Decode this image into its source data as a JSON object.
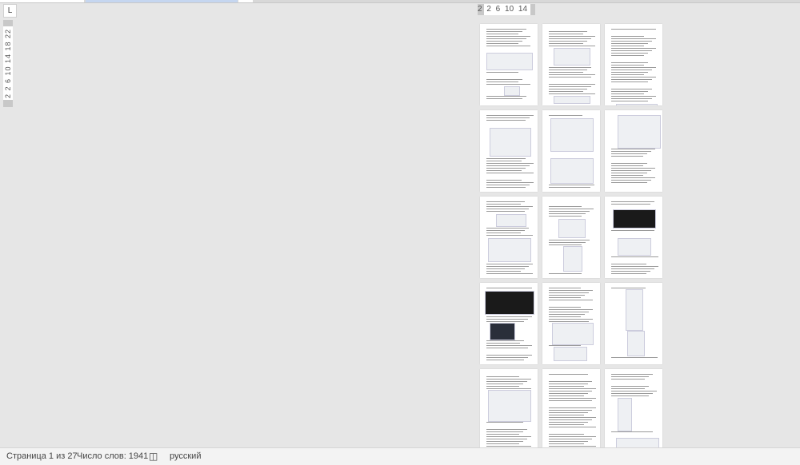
{
  "ruler": {
    "vertical_numbers": "2 2 6 10 14 18 22",
    "horizontal_numbers": "2 2 6 10 14",
    "tab_selector_symbol": "L"
  },
  "document": {
    "visible_page_count": 15,
    "columns": 3
  },
  "status": {
    "page": "Страница 1 из 27",
    "words": "Число слов: 1941",
    "proofing_icon": "book-check-icon",
    "language": "русский"
  },
  "colors": {
    "background": "#e6e6e6",
    "scroll_accent": "#c5d6f0"
  }
}
